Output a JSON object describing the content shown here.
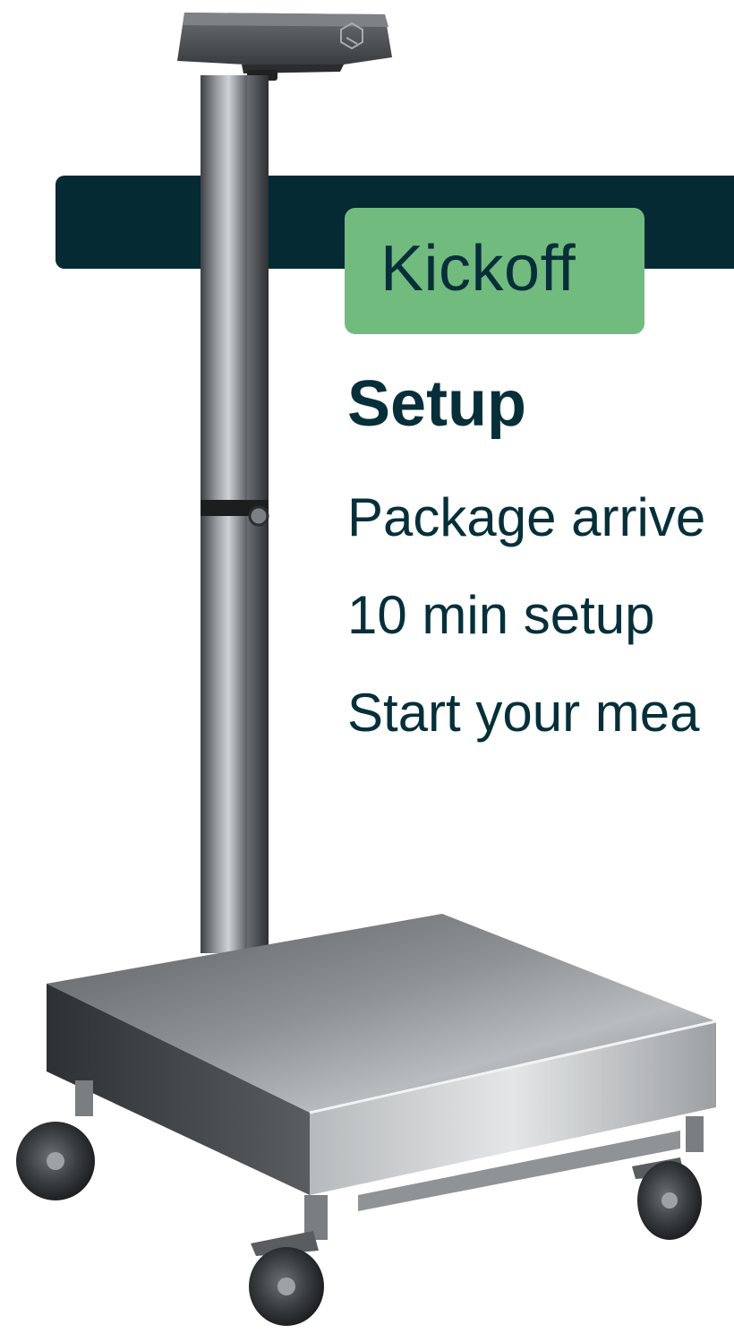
{
  "kickoff": {
    "label": "Kickoff"
  },
  "section": {
    "title": "Setup",
    "steps": [
      "Package arrive",
      "10 min setup",
      "Start your mea"
    ]
  },
  "colors": {
    "banner_dark": "#052a33",
    "badge_green": "#72bb7f",
    "text_dark": "#062f3a",
    "metal_light": "#c9cbcd",
    "metal_dark": "#4b4f53"
  },
  "icons": {
    "scale_head_logo": "hexagon-logo-icon"
  }
}
